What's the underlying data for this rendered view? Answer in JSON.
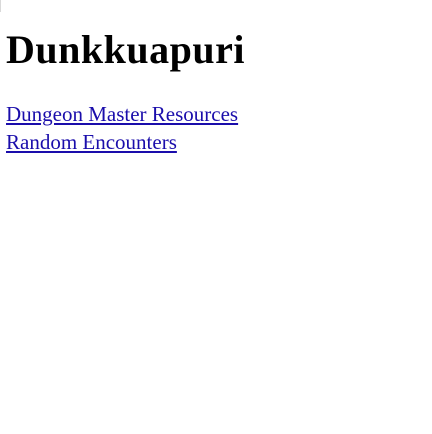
{
  "page": {
    "title": "Dunkkuapuri"
  },
  "links": [
    {
      "label": "Dungeon Master Resources"
    },
    {
      "label": "Random Encounters"
    }
  ],
  "colors": {
    "link": "#1a0dab",
    "text": "#000000",
    "background": "#ffffff"
  }
}
